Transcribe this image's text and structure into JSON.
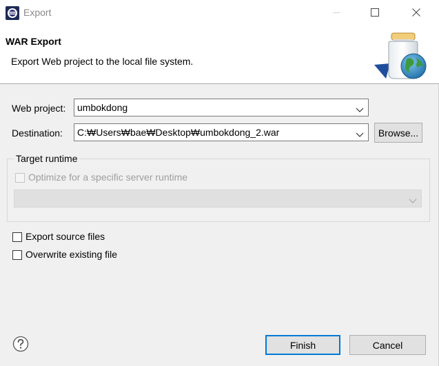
{
  "window": {
    "title": "Export"
  },
  "banner": {
    "title": "WAR Export",
    "description": "Export Web project to the local file system."
  },
  "form": {
    "web_project_label": "Web project:",
    "web_project_value": "umbokdong",
    "destination_label": "Destination:",
    "destination_value": "C:₩Users₩bae₩Desktop₩umbokdong_2.war",
    "browse_label": "Browse..."
  },
  "target_runtime": {
    "group_title": "Target runtime",
    "optimize_label": "Optimize for a specific server runtime",
    "optimize_checked": false,
    "runtime_value": ""
  },
  "options": {
    "export_source_label": "Export source files",
    "export_source_checked": false,
    "overwrite_label": "Overwrite existing file",
    "overwrite_checked": false
  },
  "footer": {
    "finish_label": "Finish",
    "cancel_label": "Cancel"
  },
  "colors": {
    "accent": "#0078d7",
    "background": "#f0f0f0",
    "banner": "#ffffff"
  }
}
